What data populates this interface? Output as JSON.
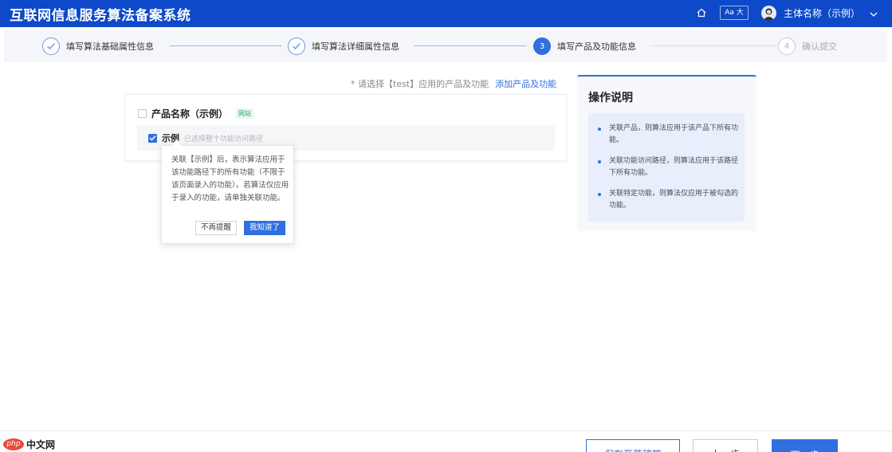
{
  "header": {
    "app_title": "互联网信息服务算法备案系统",
    "font_size_toggle": "Aa 大",
    "user_name": "主体名称（示例）",
    "home_icon": "home-icon",
    "user_menu_icon": "chevron-down-icon"
  },
  "steps": [
    {
      "number": "1",
      "label": "填写算法基础属性信息",
      "status": "done"
    },
    {
      "number": "2",
      "label": "填写算法详细属性信息",
      "status": "done"
    },
    {
      "number": "3",
      "label": "填写产品及功能信息",
      "status": "active"
    },
    {
      "number": "4",
      "label": "确认提交",
      "status": "pending"
    }
  ],
  "hint": {
    "text": "* 请选择【test】应用的产品及功能",
    "add_link": "添加产品及功能"
  },
  "product": {
    "name": "产品名称（示例）",
    "tag": "网站",
    "checked": false,
    "feature": {
      "name": "示例",
      "note": "已选择整个功能访问路径",
      "checked": true
    }
  },
  "tooltip": {
    "text": "关联【示例】后，表示算法应用于该功能路径下的所有功能（不限于该页面录入的功能）。若算法仅应用于录入的功能，请单独关联功能。",
    "dismiss_label": "不再提醒",
    "ok_label": "我知道了"
  },
  "help": {
    "title": "操作说明",
    "items": [
      "关联产品，则算法应用于该产品下所有功能。",
      "关联功能访问路径，则算法应用于该路径下所有功能。",
      "关联特定功能，则算法仅应用于被勾选的功能。"
    ]
  },
  "footer": {
    "logo_php": "php",
    "logo_text": "中文网",
    "save_draft": "保存至草稿箱",
    "prev": "上一步",
    "next": "下一步"
  },
  "colors": {
    "header_bg": "#0d49c8",
    "accent": "#2f6fe0",
    "tag_green": "#2ba66c"
  }
}
